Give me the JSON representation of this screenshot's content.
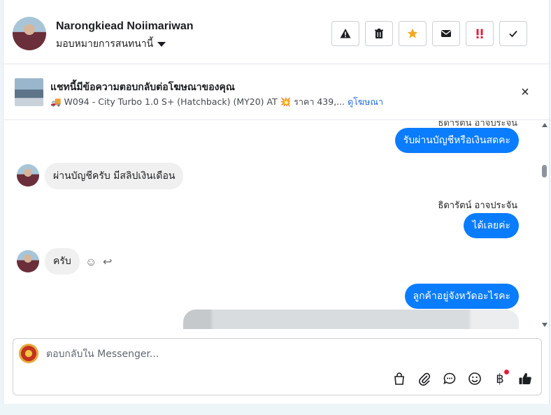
{
  "header": {
    "name": "Narongkiead Noiimariwan",
    "assign_label": "มอบหมายการสนทนานี้",
    "actions": [
      {
        "name": "warning-icon",
        "glyph": "⚠"
      },
      {
        "name": "trash-icon",
        "glyph": "🗑"
      },
      {
        "name": "star-icon",
        "glyph": "★"
      },
      {
        "name": "mail-icon",
        "glyph": "✉"
      },
      {
        "name": "priority-icon",
        "glyph": "‼"
      },
      {
        "name": "check-icon",
        "glyph": "✓"
      }
    ]
  },
  "ad": {
    "title": "แชทนี้มีข้อความตอบกลับต่อโฆษณาของคุณ",
    "subtitle": "🚚 W094 - City Turbo 1.0 S+ (Hatchback) (MY20) AT 💥 ราคา 439,...",
    "link": "ดูโฆษณา"
  },
  "messages": {
    "cut_sender": "ธิดารัตน์ อาจประจัน",
    "m1": "รับผ่านบัญชีหรือเงินสดคะ",
    "m2": "ผ่านบัญชีครับ มีสลิปเงินเดือน",
    "sender2": "ธิดารัตน์ อาจประจัน",
    "m3": "ได้เลยค่ะ",
    "m4": "ครับ",
    "m5": "ลูกค้าอยู่จังหวัดอะไรคะ"
  },
  "composer": {
    "placeholder": "ตอบกลับใน Messenger..."
  },
  "colors": {
    "accent": "#0a7cff",
    "star": "#f5a623",
    "priority": "#e41e3f"
  }
}
